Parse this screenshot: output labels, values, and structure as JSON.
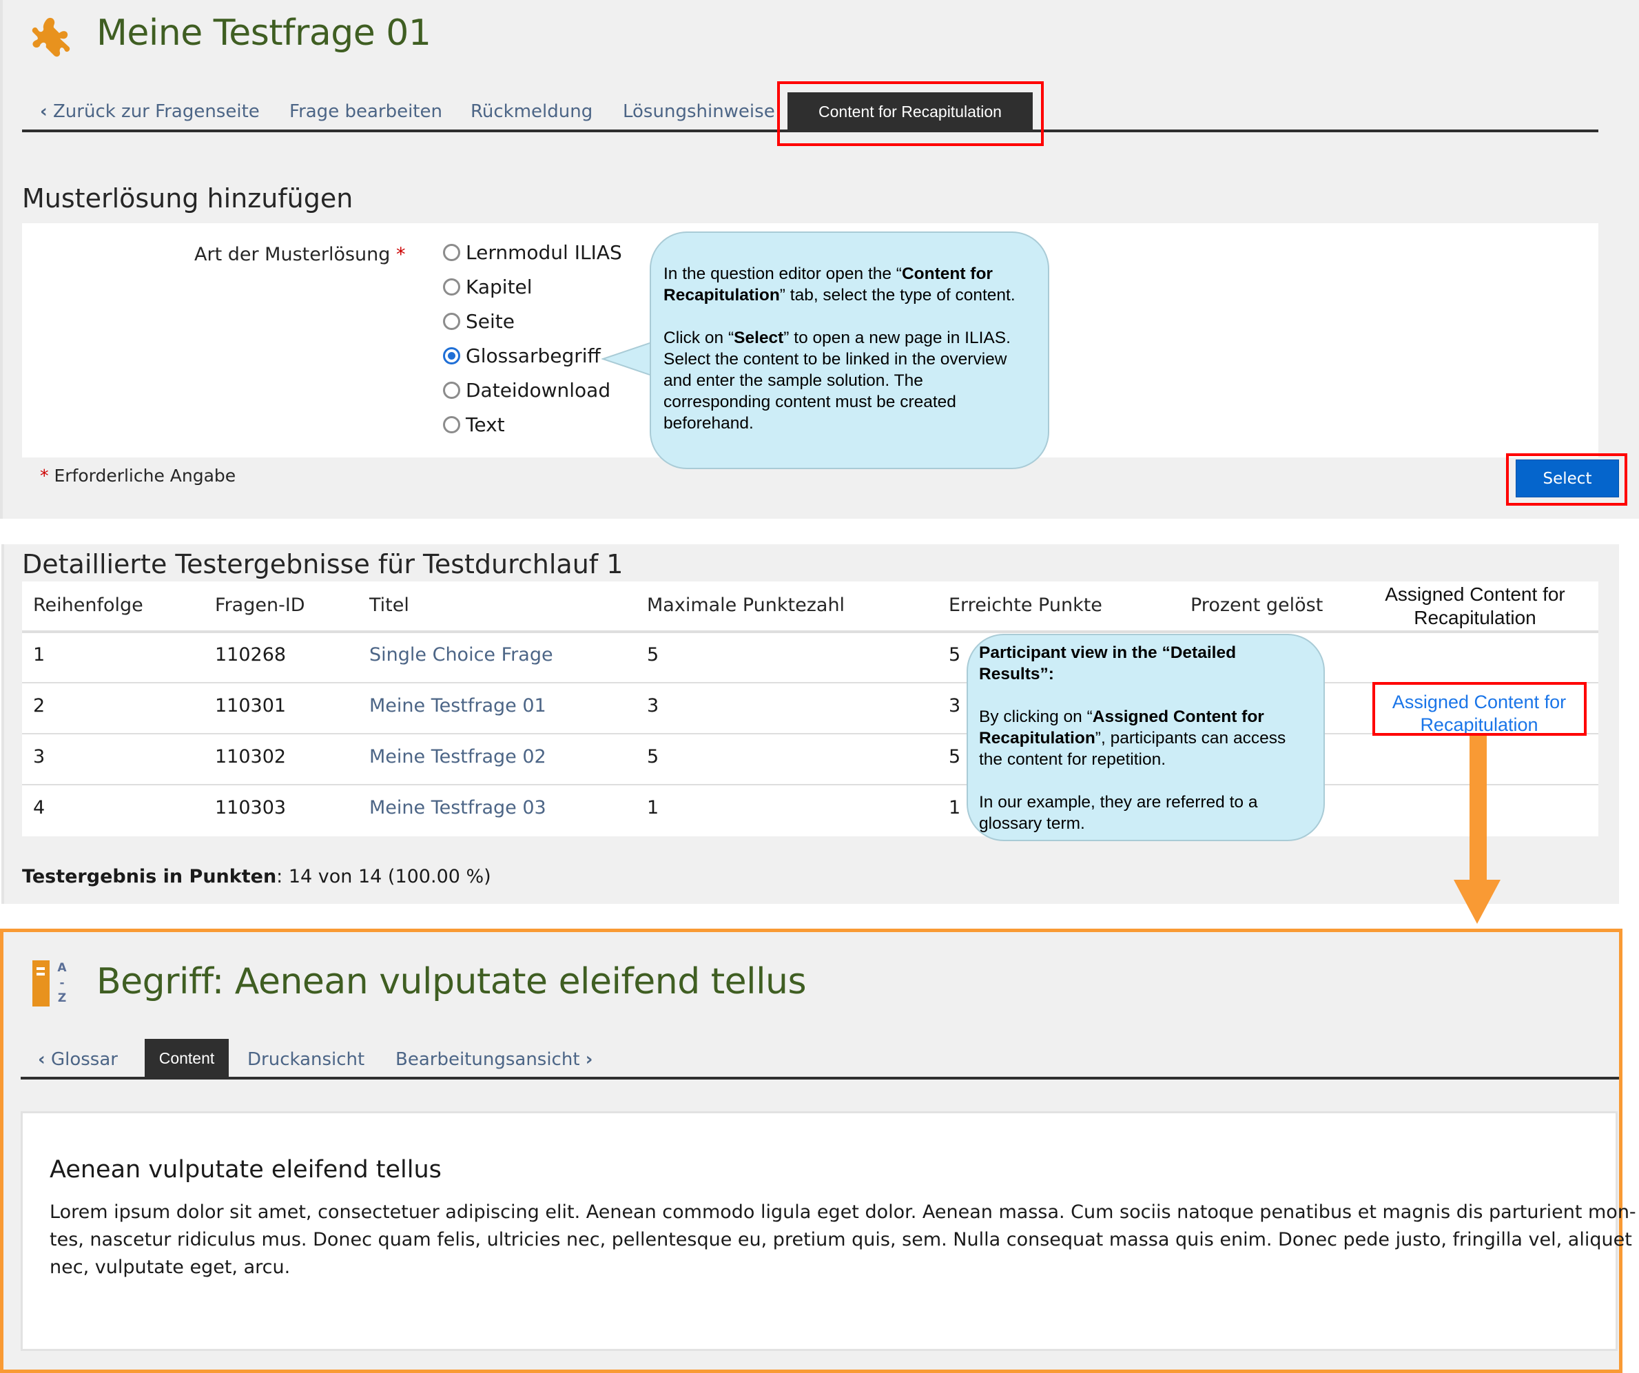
{
  "editor": {
    "title": "Meine Testfrage 01",
    "tabs": [
      {
        "label": "Zurück zur Fragenseite",
        "back": true
      },
      {
        "label": "Frage bearbeiten"
      },
      {
        "label": "Rückmeldung"
      },
      {
        "label": "Lösungshinweise"
      },
      {
        "label": "Content for Recapitulation",
        "active": true
      }
    ],
    "section_title": "Musterlösung hinzufügen",
    "field_label": "Art der Musterlösung",
    "required_mark": "*",
    "options": [
      {
        "label": "Lernmodul ILIAS",
        "checked": false
      },
      {
        "label": "Kapitel",
        "checked": false
      },
      {
        "label": "Seite",
        "checked": false
      },
      {
        "label": "Glossarbegriff",
        "checked": true
      },
      {
        "label": "Dateidownload",
        "checked": false
      },
      {
        "label": "Text",
        "checked": false
      }
    ],
    "required_note": "Erforderliche Angabe",
    "select_button": "Select"
  },
  "callout1": {
    "p1_a": "In the question editor open the “",
    "p1_b": "Content for Recapitulation",
    "p1_c": "” tab, select the type of content.",
    "p2_a": "Click on “",
    "p2_b": "Select",
    "p2_c": "” to open a new page in ILIAS. Select the content to be linked in the overview and enter the sample solution. The corresponding content must be created beforehand."
  },
  "results": {
    "title": "Detaillierte Testergebnisse für Testdurchlauf 1",
    "columns": [
      "Reihenfolge",
      "Fragen-ID",
      "Titel",
      "Maximale Punktezahl",
      "Erreichte Punkte",
      "Prozent gelöst",
      "Assigned Content for Recapitulation"
    ],
    "rows": [
      {
        "order": "1",
        "id": "110268",
        "title": "Single Choice Frage",
        "max": "5",
        "reached": "5",
        "percent": "",
        "recap": ""
      },
      {
        "order": "2",
        "id": "110301",
        "title": "Meine Testfrage 01",
        "max": "3",
        "reached": "3",
        "percent": "",
        "recap": "Assigned Content for Recapitulation"
      },
      {
        "order": "3",
        "id": "110302",
        "title": "Meine Testfrage 02",
        "max": "5",
        "reached": "5",
        "percent": "",
        "recap": ""
      },
      {
        "order": "4",
        "id": "110303",
        "title": "Meine Testfrage 03",
        "max": "1",
        "reached": "1",
        "percent": "",
        "recap": ""
      }
    ],
    "summary_label": "Testergebnis in Punkten",
    "summary_value": ": 14 von 14 (100.00 %)"
  },
  "callout2": {
    "h": "Participant view in the “Detailed Results”:",
    "p1_a": "By clicking on “",
    "p1_b": "Assigned Content for Recapitulation",
    "p1_c": "”, participants can access the content for repetition.",
    "p2": "In our example, they are referred to a glossary term."
  },
  "glossary": {
    "title": "Begriff: Aenean vulputate eleifend tellus",
    "tabs": [
      {
        "label": "Glossar",
        "back": true
      },
      {
        "label": "Content",
        "active": true
      },
      {
        "label": "Druckansicht"
      },
      {
        "label": "Bearbeitungsansicht",
        "forward": true
      }
    ],
    "term": "Aenean vulputate eleifend tellus",
    "definition_lines": [
      "Lorem ipsum dolor sit amet, consectetuer adipiscing elit. Aenean commodo ligula eget dolor. Aenean massa. Cum sociis natoque penatibus et magnis dis parturient mon-",
      "tes, nascetur ridiculus mus. Donec quam felis, ultricies nec, pellentesque eu, pretium quis, sem. Nulla consequat massa quis enim. Donec pede justo, fringilla vel, aliquet",
      "nec, vulputate eget, arcu."
    ],
    "icon_letters": {
      "top": "A",
      "mid": "-",
      "bottom": "Z"
    }
  },
  "colors": {
    "title_green": "#3f5e22",
    "link_blue": "#4c6586",
    "primary": "#0565cc",
    "highlight_red": "#ff0000",
    "arrow_orange": "#f99a34",
    "callout_bg": "#cdedf7",
    "icon_orange": "#e8921e"
  }
}
